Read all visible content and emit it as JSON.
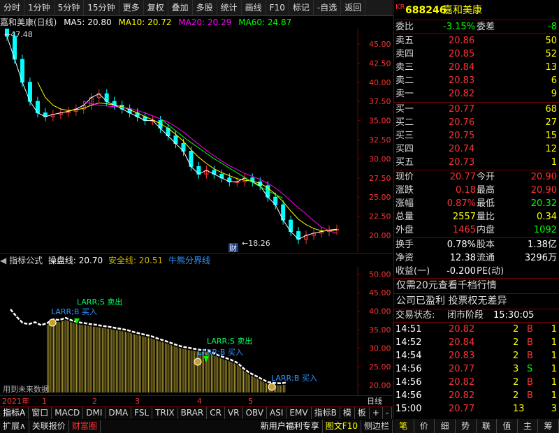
{
  "toolbar": {
    "items": [
      "分时",
      "1分钟",
      "5分钟",
      "15分钟",
      "更多",
      "复权",
      "叠加",
      "多股",
      "统计",
      "画线",
      "F10",
      "标记",
      "-自选",
      "返回"
    ]
  },
  "chart_title": {
    "name": "嘉和美康(日线)",
    "ma5": "MA5: 20.80",
    "ma10": "MA10: 20.72",
    "ma20": "MA20: 20.29",
    "ma60": "MA60: 24.87"
  },
  "colors": {
    "ma5": "#ffffff",
    "ma10": "#ffff00",
    "ma20": "#ff00ff",
    "ma60": "#00ff00",
    "up": "#ff3232",
    "down": "#00ffff",
    "grid": "#7a0000"
  },
  "chart_data": [
    {
      "type": "candlestick",
      "title": "",
      "ylim": [
        18,
        47
      ],
      "y_ticks": [
        "45.00",
        "42.50",
        "40.00",
        "37.50",
        "35.00",
        "32.50",
        "30.00",
        "27.50",
        "25.00",
        "22.50",
        "20.00"
      ],
      "max_label": "47.48",
      "min_label": "18.26",
      "annotation": "财",
      "series": [
        {
          "name": "MA5",
          "values": [
            46,
            43,
            40,
            37.5,
            36,
            35.5,
            35.8,
            36,
            36.2,
            36.5,
            37,
            38,
            38.5,
            37.5,
            37,
            36.5,
            36,
            35.5,
            35,
            35,
            34,
            33,
            32,
            31,
            29,
            28,
            28.5,
            28,
            27.5,
            27,
            27,
            27.5,
            27,
            26.5,
            25,
            24,
            22,
            20.5,
            19.5,
            20,
            20.3,
            20.5,
            20.7,
            20.8
          ]
        },
        {
          "name": "MA10",
          "values": [
            null,
            null,
            null,
            null,
            40,
            38,
            37,
            36.5,
            36.3,
            36.4,
            36.6,
            37,
            37.3,
            37.2,
            37,
            36.8,
            36.4,
            36,
            35.5,
            35.1,
            34.6,
            34,
            33.2,
            32.3,
            31.2,
            30.2,
            29.4,
            28.7,
            28.2,
            27.8,
            27.4,
            27.2,
            27.1,
            26.8,
            26.2,
            25.4,
            24.4,
            23.2,
            22.1,
            21.4,
            20.9,
            20.6,
            20.6,
            20.72
          ]
        },
        {
          "name": "MA20",
          "values": [
            null,
            null,
            null,
            null,
            null,
            null,
            null,
            null,
            null,
            null,
            37.5,
            37.2,
            37,
            36.9,
            36.8,
            36.7,
            36.6,
            36.3,
            36,
            35.6,
            35.2,
            34.8,
            34.2,
            33.5,
            32.7,
            31.9,
            31.1,
            30.4,
            29.7,
            29.1,
            28.6,
            28.1,
            27.7,
            27.3,
            26.8,
            26.2,
            25.4,
            24.5,
            23.6,
            22.8,
            21.9,
            21.1,
            20.6,
            20.29
          ]
        },
        {
          "name": "MA60",
          "values": [
            null,
            null,
            null,
            null,
            null,
            null,
            null,
            null,
            null,
            null,
            null,
            null,
            null,
            null,
            null,
            null,
            null,
            null,
            null,
            null,
            null,
            null,
            35.2,
            34.3,
            33.4,
            32.5,
            31.7,
            30.9,
            30.1,
            29.4,
            28.7,
            28,
            27.3,
            26.6,
            26,
            25.4,
            24.87
          ]
        }
      ]
    },
    {
      "type": "line",
      "title": "",
      "ylim": [
        18,
        52
      ],
      "y_ticks": [
        "50.00",
        "45.00",
        "40.00",
        "35.00",
        "30.00",
        "25.00",
        "20.00"
      ],
      "series": [
        {
          "name": "操盘线",
          "values": [
            40.5,
            38.5,
            36.8,
            36.5,
            37,
            36.2,
            36.8,
            37.8,
            37.6,
            38.2,
            37.5,
            37,
            36.8,
            36.5,
            36.3,
            36,
            35.8,
            35.5,
            35.2,
            34.9,
            34.4,
            34,
            33.6,
            33.2,
            32.6,
            32.1,
            31.5,
            30.9,
            30.4,
            30.1,
            29.8,
            29.5,
            29.5,
            28.7,
            28,
            27.4,
            26.8,
            26,
            24.5,
            23.3,
            22.5,
            21.6,
            20.8,
            20.6,
            20.5,
            20.7
          ]
        }
      ]
    }
  ],
  "indicator": {
    "label": "指标公式",
    "line1": "操盘线: 20.70",
    "line2": "安全线: 20.51",
    "line3": "牛熊分界线",
    "annotations": [
      "LARR;S 卖出",
      "LARR;B 买入",
      "LARR;S 卖出",
      "LARR;B 买入",
      "LARR;B 买入"
    ],
    "footer": "用到未来数据"
  },
  "time_axis": {
    "year": "2021年",
    "months": [
      "1",
      "2",
      "3",
      "4",
      "5"
    ],
    "right_label": "日线"
  },
  "tabs1": [
    "指标A",
    "窗口",
    "MACD",
    "DMI",
    "DMA",
    "FSL",
    "TRIX",
    "BRAR",
    "CR",
    "VR",
    "OBV",
    "ASI",
    "EMV",
    "指标B",
    "模",
    "板",
    "+",
    "-"
  ],
  "tabs2": [
    "扩展∧",
    "关联报价",
    "财富圈",
    "新用户福利专享",
    "图文F10",
    "侧边栏"
  ],
  "quote": {
    "badge": "KR",
    "code": "688246",
    "name": "嘉和美康",
    "webi_label": "委比",
    "webi_value": "-3.15%",
    "weicha_label": "委差",
    "weicha_value": "-8",
    "asks": [
      {
        "label": "卖五",
        "price": "20.86",
        "vol": "50"
      },
      {
        "label": "卖四",
        "price": "20.85",
        "vol": "52"
      },
      {
        "label": "卖三",
        "price": "20.84",
        "vol": "13"
      },
      {
        "label": "卖二",
        "price": "20.83",
        "vol": "6"
      },
      {
        "label": "卖一",
        "price": "20.82",
        "vol": "9"
      }
    ],
    "bids": [
      {
        "label": "买一",
        "price": "20.77",
        "vol": "68"
      },
      {
        "label": "买二",
        "price": "20.76",
        "vol": "27"
      },
      {
        "label": "买三",
        "price": "20.75",
        "vol": "15"
      },
      {
        "label": "买四",
        "price": "20.74",
        "vol": "12"
      },
      {
        "label": "买五",
        "price": "20.73",
        "vol": "1"
      }
    ],
    "stats": [
      {
        "l1": "现价",
        "v1": "20.77",
        "l2": "今开",
        "v2": "20.90"
      },
      {
        "l1": "涨跌",
        "v1": "0.18",
        "l2": "最高",
        "v2": "20.90"
      },
      {
        "l1": "涨幅",
        "v1": "0.87%",
        "l2": "最低",
        "v2": "20.32"
      },
      {
        "l1": "总量",
        "v1": "2557",
        "l2": "量比",
        "v2": "0.34"
      },
      {
        "l1": "外盘",
        "v1": "1465",
        "l2": "内盘",
        "v2": "1092"
      }
    ],
    "stats2": [
      {
        "l1": "换手",
        "v1": "0.78%",
        "l2": "股本",
        "v2": "1.38亿"
      },
      {
        "l1": "净资",
        "v1": "12.38",
        "l2": "流通",
        "v2": "3296万"
      },
      {
        "l1": "收益(一)",
        "v1": "-0.200",
        "l2": "PE(动)",
        "v2": ""
      }
    ],
    "promo1": "仅需20元查看千档行情",
    "promo2": "公司已盈利 投票权无差异",
    "status_label": "交易状态:",
    "status_value": "闭市阶段",
    "status_time": "15:30:05",
    "ticks": [
      {
        "time": "14:51",
        "price": "20.82",
        "vol": "2",
        "side": "B",
        "n": "1"
      },
      {
        "time": "14:52",
        "price": "20.84",
        "vol": "2",
        "side": "B",
        "n": "1"
      },
      {
        "time": "14:54",
        "price": "20.83",
        "vol": "2",
        "side": "B",
        "n": "1"
      },
      {
        "time": "14:56",
        "price": "20.77",
        "vol": "3",
        "side": "S",
        "n": "1"
      },
      {
        "time": "14:56",
        "price": "20.82",
        "vol": "2",
        "side": "B",
        "n": "1"
      },
      {
        "time": "14:56",
        "price": "20.82",
        "vol": "2",
        "side": "B",
        "n": "1"
      },
      {
        "time": "15:00",
        "price": "20.77",
        "vol": "13",
        "side": "",
        "n": "3"
      }
    ],
    "right_tabs": [
      "笔",
      "价",
      "细",
      "势",
      "联",
      "值",
      "主",
      "筹"
    ]
  }
}
